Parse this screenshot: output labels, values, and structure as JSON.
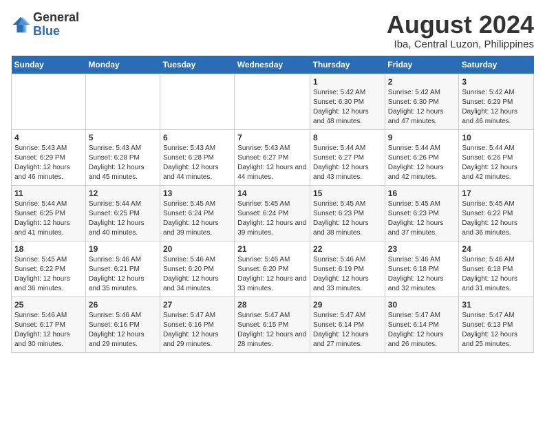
{
  "logo": {
    "general": "General",
    "blue": "Blue"
  },
  "title": {
    "month_year": "August 2024",
    "location": "Iba, Central Luzon, Philippines"
  },
  "days_of_week": [
    "Sunday",
    "Monday",
    "Tuesday",
    "Wednesday",
    "Thursday",
    "Friday",
    "Saturday"
  ],
  "weeks": [
    [
      {
        "day": "",
        "info": ""
      },
      {
        "day": "",
        "info": ""
      },
      {
        "day": "",
        "info": ""
      },
      {
        "day": "",
        "info": ""
      },
      {
        "day": "1",
        "info": "Sunrise: 5:42 AM\nSunset: 6:30 PM\nDaylight: 12 hours and 48 minutes."
      },
      {
        "day": "2",
        "info": "Sunrise: 5:42 AM\nSunset: 6:30 PM\nDaylight: 12 hours and 47 minutes."
      },
      {
        "day": "3",
        "info": "Sunrise: 5:42 AM\nSunset: 6:29 PM\nDaylight: 12 hours and 46 minutes."
      }
    ],
    [
      {
        "day": "4",
        "info": "Sunrise: 5:43 AM\nSunset: 6:29 PM\nDaylight: 12 hours and 46 minutes."
      },
      {
        "day": "5",
        "info": "Sunrise: 5:43 AM\nSunset: 6:28 PM\nDaylight: 12 hours and 45 minutes."
      },
      {
        "day": "6",
        "info": "Sunrise: 5:43 AM\nSunset: 6:28 PM\nDaylight: 12 hours and 44 minutes."
      },
      {
        "day": "7",
        "info": "Sunrise: 5:43 AM\nSunset: 6:27 PM\nDaylight: 12 hours and 44 minutes."
      },
      {
        "day": "8",
        "info": "Sunrise: 5:44 AM\nSunset: 6:27 PM\nDaylight: 12 hours and 43 minutes."
      },
      {
        "day": "9",
        "info": "Sunrise: 5:44 AM\nSunset: 6:26 PM\nDaylight: 12 hours and 42 minutes."
      },
      {
        "day": "10",
        "info": "Sunrise: 5:44 AM\nSunset: 6:26 PM\nDaylight: 12 hours and 42 minutes."
      }
    ],
    [
      {
        "day": "11",
        "info": "Sunrise: 5:44 AM\nSunset: 6:25 PM\nDaylight: 12 hours and 41 minutes."
      },
      {
        "day": "12",
        "info": "Sunrise: 5:44 AM\nSunset: 6:25 PM\nDaylight: 12 hours and 40 minutes."
      },
      {
        "day": "13",
        "info": "Sunrise: 5:45 AM\nSunset: 6:24 PM\nDaylight: 12 hours and 39 minutes."
      },
      {
        "day": "14",
        "info": "Sunrise: 5:45 AM\nSunset: 6:24 PM\nDaylight: 12 hours and 39 minutes."
      },
      {
        "day": "15",
        "info": "Sunrise: 5:45 AM\nSunset: 6:23 PM\nDaylight: 12 hours and 38 minutes."
      },
      {
        "day": "16",
        "info": "Sunrise: 5:45 AM\nSunset: 6:23 PM\nDaylight: 12 hours and 37 minutes."
      },
      {
        "day": "17",
        "info": "Sunrise: 5:45 AM\nSunset: 6:22 PM\nDaylight: 12 hours and 36 minutes."
      }
    ],
    [
      {
        "day": "18",
        "info": "Sunrise: 5:45 AM\nSunset: 6:22 PM\nDaylight: 12 hours and 36 minutes."
      },
      {
        "day": "19",
        "info": "Sunrise: 5:46 AM\nSunset: 6:21 PM\nDaylight: 12 hours and 35 minutes."
      },
      {
        "day": "20",
        "info": "Sunrise: 5:46 AM\nSunset: 6:20 PM\nDaylight: 12 hours and 34 minutes."
      },
      {
        "day": "21",
        "info": "Sunrise: 5:46 AM\nSunset: 6:20 PM\nDaylight: 12 hours and 33 minutes."
      },
      {
        "day": "22",
        "info": "Sunrise: 5:46 AM\nSunset: 6:19 PM\nDaylight: 12 hours and 33 minutes."
      },
      {
        "day": "23",
        "info": "Sunrise: 5:46 AM\nSunset: 6:18 PM\nDaylight: 12 hours and 32 minutes."
      },
      {
        "day": "24",
        "info": "Sunrise: 5:46 AM\nSunset: 6:18 PM\nDaylight: 12 hours and 31 minutes."
      }
    ],
    [
      {
        "day": "25",
        "info": "Sunrise: 5:46 AM\nSunset: 6:17 PM\nDaylight: 12 hours and 30 minutes."
      },
      {
        "day": "26",
        "info": "Sunrise: 5:46 AM\nSunset: 6:16 PM\nDaylight: 12 hours and 29 minutes."
      },
      {
        "day": "27",
        "info": "Sunrise: 5:47 AM\nSunset: 6:16 PM\nDaylight: 12 hours and 29 minutes."
      },
      {
        "day": "28",
        "info": "Sunrise: 5:47 AM\nSunset: 6:15 PM\nDaylight: 12 hours and 28 minutes."
      },
      {
        "day": "29",
        "info": "Sunrise: 5:47 AM\nSunset: 6:14 PM\nDaylight: 12 hours and 27 minutes."
      },
      {
        "day": "30",
        "info": "Sunrise: 5:47 AM\nSunset: 6:14 PM\nDaylight: 12 hours and 26 minutes."
      },
      {
        "day": "31",
        "info": "Sunrise: 5:47 AM\nSunset: 6:13 PM\nDaylight: 12 hours and 25 minutes."
      }
    ]
  ]
}
